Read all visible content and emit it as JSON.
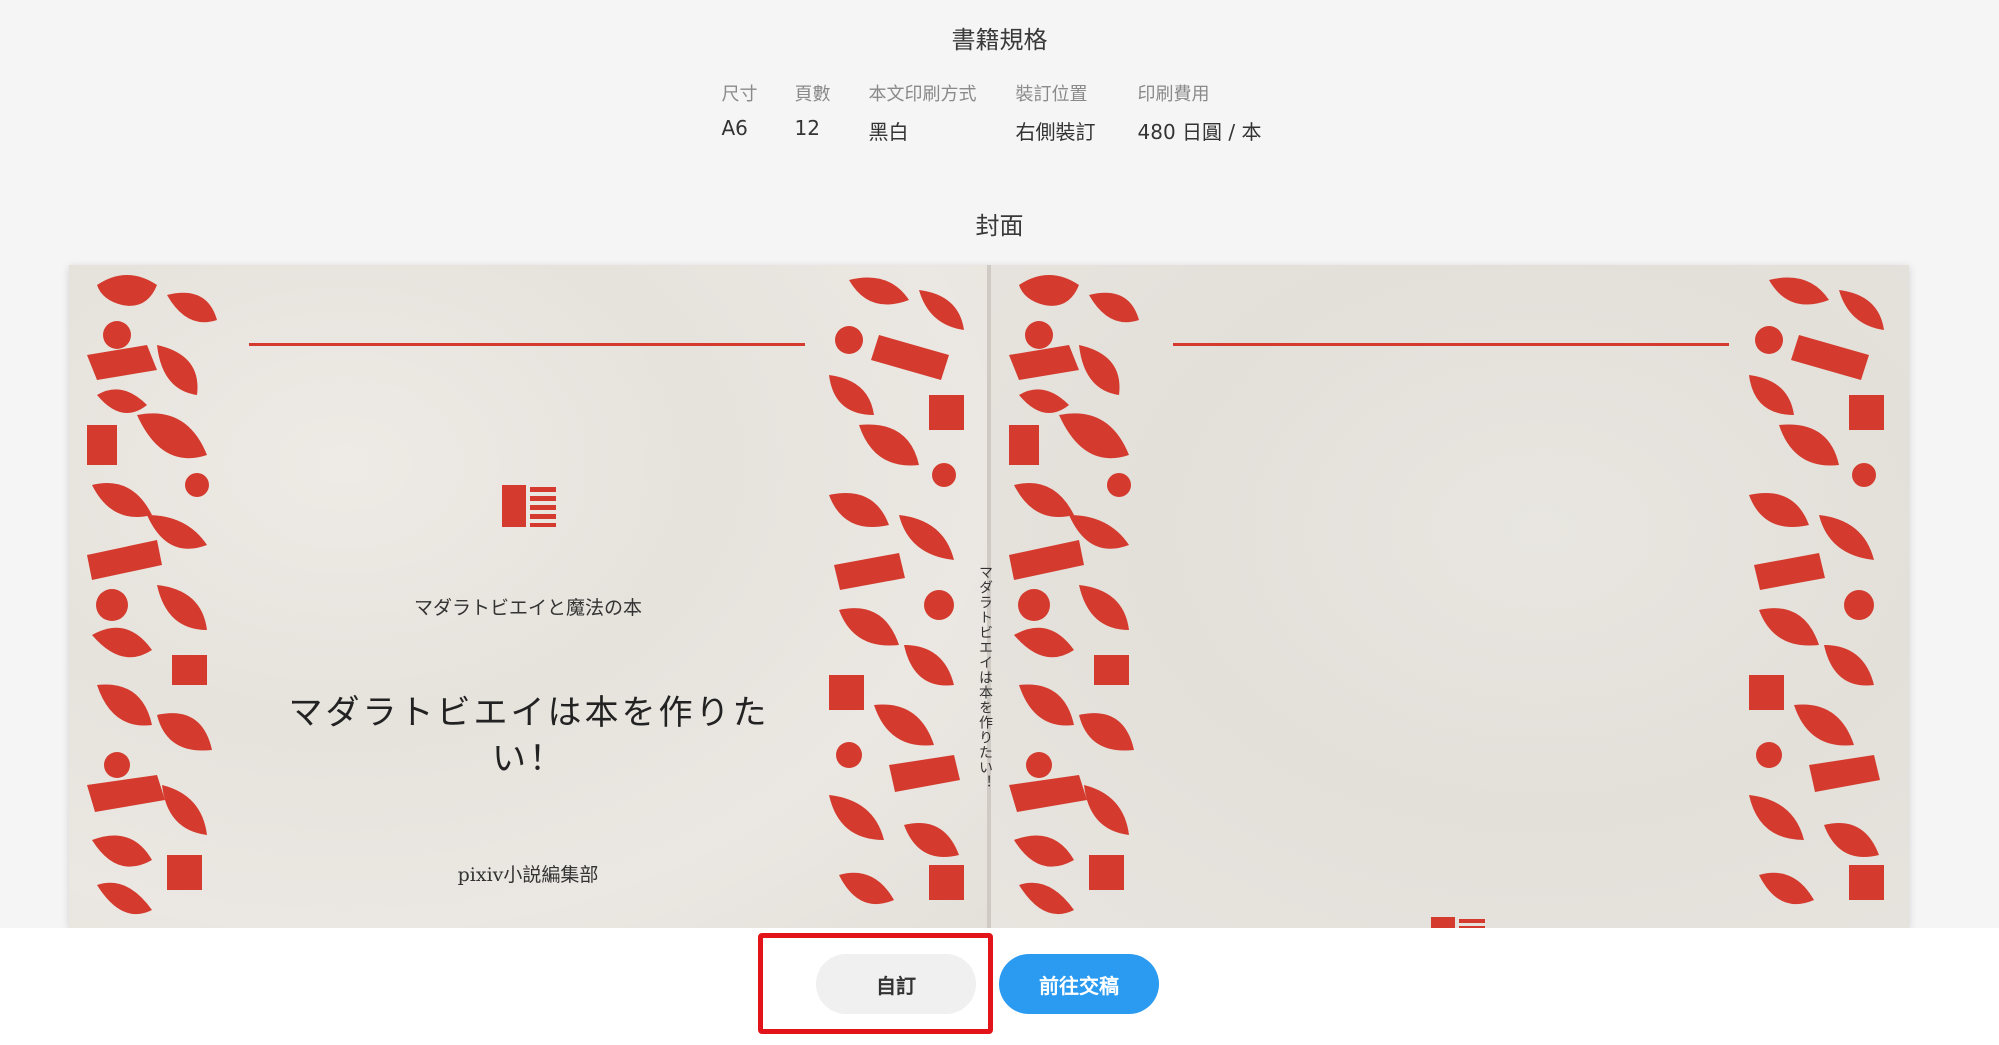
{
  "specs": {
    "title": "書籍規格",
    "items": [
      {
        "label": "尺寸",
        "value": "A6"
      },
      {
        "label": "頁數",
        "value": "12"
      },
      {
        "label": "本文印刷方式",
        "value": "黑白"
      },
      {
        "label": "裝訂位置",
        "value": "右側裝訂"
      },
      {
        "label": "印刷費用",
        "value": "480 日圓 / 本"
      }
    ]
  },
  "cover": {
    "title": "封面",
    "subtitle": "マダラトビエイと魔法の本",
    "main_title": "マダラトビエイは本を作りたい！",
    "author": "pixiv小説編集部",
    "spine_text": "マダラトビエイは本を作りたい！",
    "accent_color": "#d43b2e"
  },
  "actions": {
    "self_order_label": "自訂",
    "submit_label": "前往交稿"
  },
  "colors": {
    "primary_button": "#2a9bf0",
    "highlight_border": "#e2141a"
  }
}
